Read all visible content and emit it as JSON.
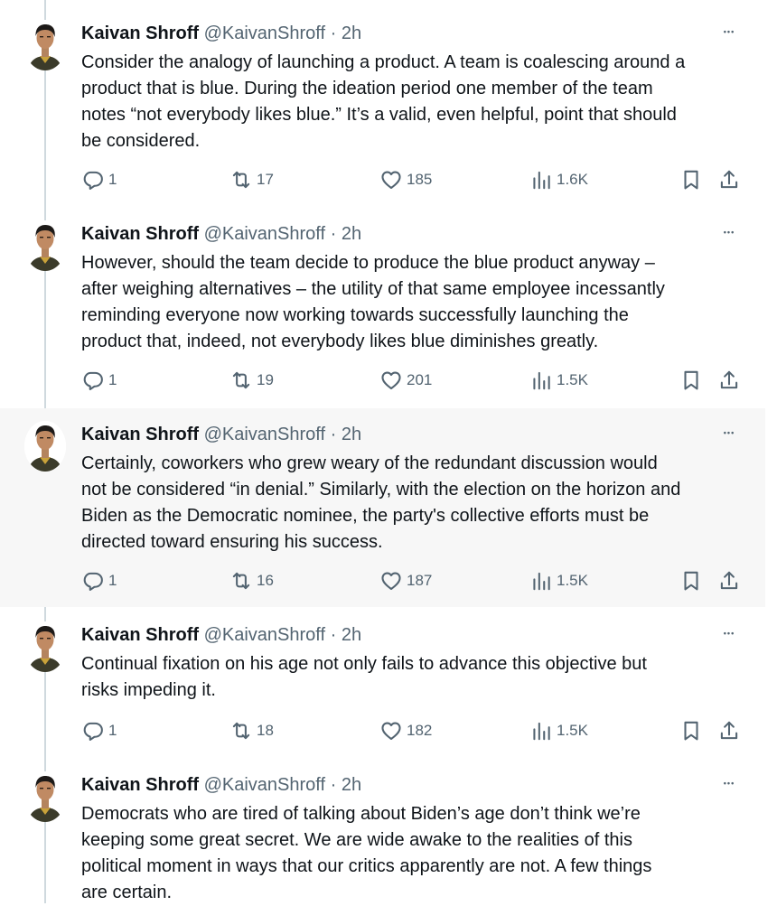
{
  "tweets": [
    {
      "name": "Kaivan Shroff",
      "handle": "@KaivanShroff",
      "time": "2h",
      "more_icon": "more-icon",
      "lines": [
        "Consider the analogy of launching a product. A team is coalescing around a",
        "product that is blue. During the ideation period one member of the team",
        "notes “not everybody likes blue.” It’s a valid, even helpful, point that should",
        "be considered."
      ],
      "replies": "1",
      "retweets": "17",
      "likes": "185",
      "views": "1.6K"
    },
    {
      "name": "Kaivan Shroff",
      "handle": "@KaivanShroff",
      "time": "2h",
      "more_icon": "more-icon",
      "lines": [
        "However, should the team decide to produce the blue product anyway –",
        "after weighing alternatives – the utility of that same employee incessantly",
        "reminding everyone now working towards successfully launching the",
        "product that, indeed, not everybody likes blue diminishes greatly."
      ],
      "replies": "1",
      "retweets": "19",
      "likes": "201",
      "views": "1.5K"
    },
    {
      "name": "Kaivan Shroff",
      "handle": "@KaivanShroff",
      "time": "2h",
      "more_icon": "more-icon",
      "lines": [
        "Certainly, coworkers who grew weary of the redundant discussion would",
        "not be considered “in denial.” Similarly, with the election on the horizon and",
        "Biden as the Democratic nominee, the party's collective efforts must be",
        "directed toward ensuring his success."
      ],
      "replies": "1",
      "retweets": "16",
      "likes": "187",
      "views": "1.5K"
    },
    {
      "name": "Kaivan Shroff",
      "handle": "@KaivanShroff",
      "time": "2h",
      "more_icon": "more-icon",
      "lines": [
        "Continual fixation on his age not only fails to advance this objective but",
        "risks impeding it."
      ],
      "replies": "1",
      "retweets": "18",
      "likes": "182",
      "views": "1.5K"
    },
    {
      "name": "Kaivan Shroff",
      "handle": "@KaivanShroff",
      "time": "2h",
      "more_icon": "more-icon",
      "lines": [
        "Democrats who are tired of talking about Biden’s age don’t think we’re",
        "keeping some great secret. We are wide awake to the realities of this",
        "political moment in ways that our critics apparently are not. A few things",
        "are certain."
      ],
      "replies": null,
      "retweets": null,
      "likes": null,
      "views": null
    }
  ],
  "separator": " · ",
  "icons": {
    "reply": "reply-icon",
    "retweet": "retweet-icon",
    "like": "like-icon",
    "views": "views-icon",
    "bookmark": "bookmark-icon",
    "share": "share-icon",
    "more": "more-icon"
  },
  "colors": {
    "text": "#0f1419",
    "secondary": "#536471",
    "thread_line": "#cfd9de",
    "highlight_background": "#f7f7f7"
  }
}
